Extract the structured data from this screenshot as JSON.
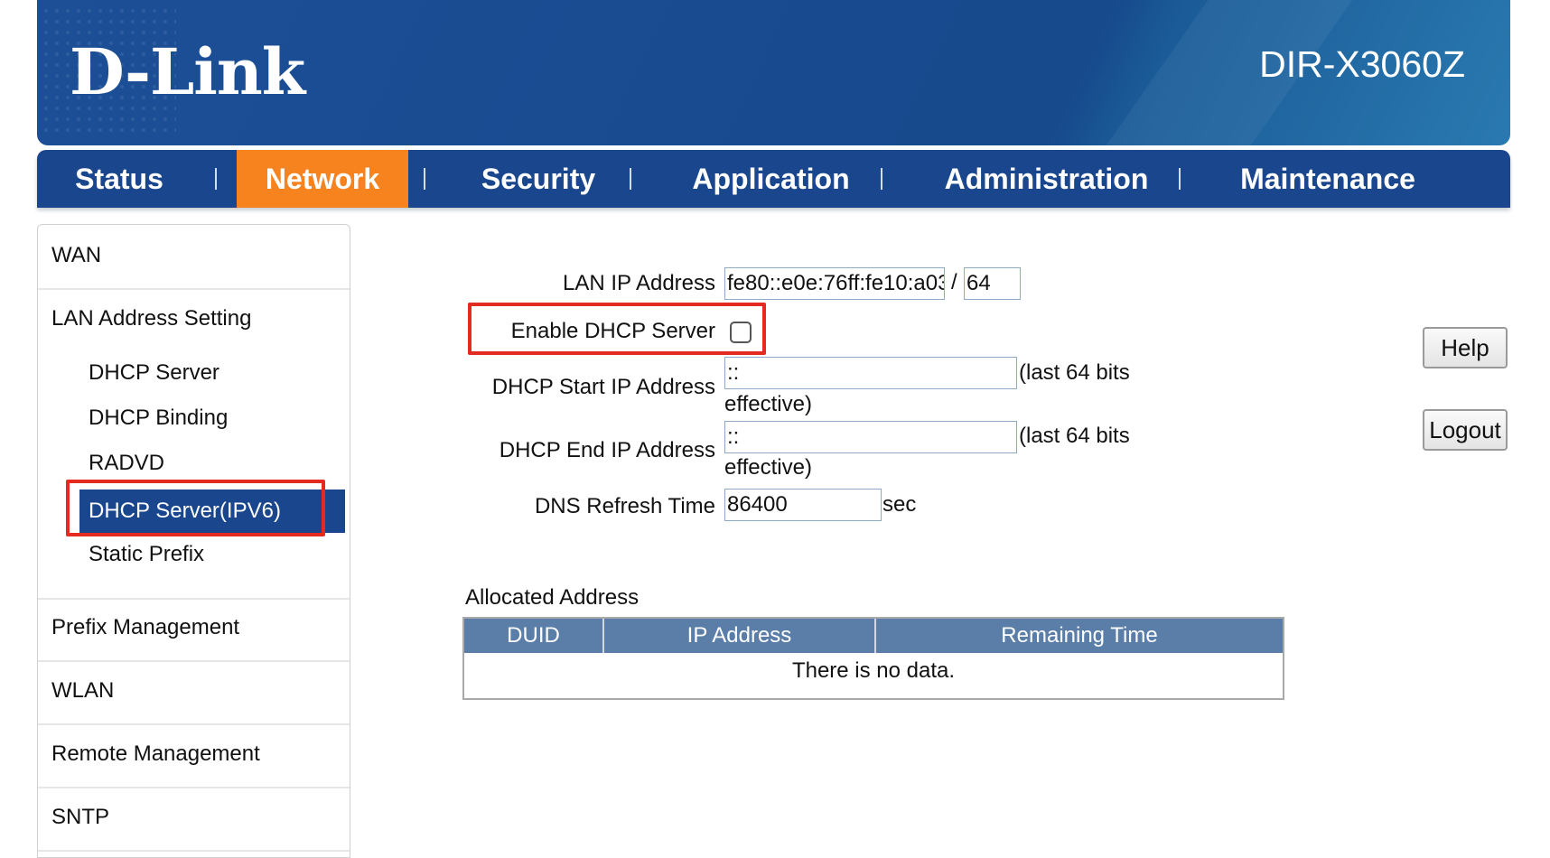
{
  "header": {
    "logo": "D-Link",
    "model": "DIR-X3060Z"
  },
  "nav": {
    "items": [
      "Status",
      "Network",
      "Security",
      "Application",
      "Administration",
      "Maintenance"
    ],
    "active": "Network"
  },
  "sidebar": {
    "wan": "WAN",
    "lan_address_setting": "LAN Address Setting",
    "sub": {
      "dhcp_server": "DHCP Server",
      "dhcp_binding": "DHCP Binding",
      "radvd": "RADVD",
      "dhcp_server_ipv6": "DHCP Server(IPV6)",
      "static_prefix": "Static Prefix"
    },
    "prefix_management": "Prefix Management",
    "wlan": "WLAN",
    "remote_management": "Remote Management",
    "sntp": "SNTP"
  },
  "form": {
    "lan_ip_label": "LAN IP Address",
    "lan_ip_value": "fe80::e0e:76ff:fe10:a03",
    "slash": "/",
    "prefix_len": "64",
    "enable_dhcp_label": "Enable DHCP Server",
    "enable_dhcp_checked": false,
    "start_label": "DHCP Start IP Address",
    "start_value": "::",
    "start_note_1": "(last 64 bits",
    "start_note_2": "effective)",
    "end_label": "DHCP End IP Address",
    "end_value": "::",
    "end_note_1": "(last 64 bits",
    "end_note_2": "effective)",
    "dns_label": "DNS Refresh Time",
    "dns_value": "86400",
    "dns_unit": "sec"
  },
  "buttons": {
    "help": "Help",
    "logout": "Logout"
  },
  "allocated": {
    "title": "Allocated Address",
    "columns": [
      "DUID",
      "IP Address",
      "Remaining Time"
    ],
    "empty_text": "There is no data."
  }
}
